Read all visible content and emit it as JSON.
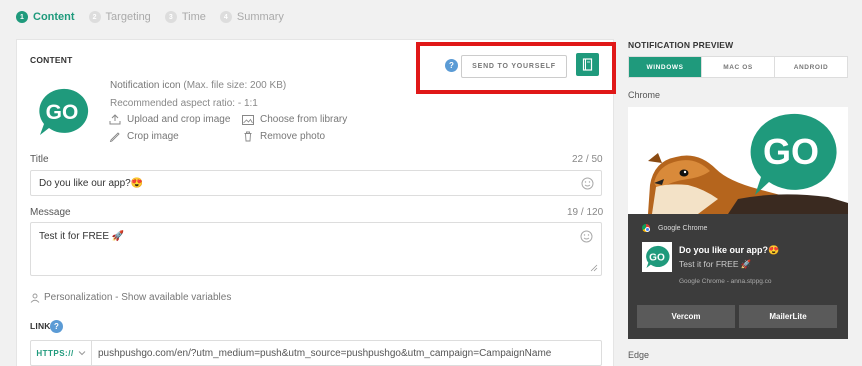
{
  "steps": [
    {
      "num": "1",
      "label": "Content"
    },
    {
      "num": "2",
      "label": "Targeting"
    },
    {
      "num": "3",
      "label": "Time"
    },
    {
      "num": "4",
      "label": "Summary"
    }
  ],
  "content": {
    "title": "CONTENT",
    "help": "?",
    "send_to_yourself": "SEND TO YOURSELF",
    "icon_info": {
      "label": "Notification icon",
      "max_size": "(Max. file size: 200 KB)",
      "aspect": "Recommended aspect ratio: - 1:1"
    },
    "upload_crop": "Upload and crop image",
    "choose_library": "Choose from library",
    "crop_image": "Crop image",
    "remove_photo": "Remove photo",
    "logo_text": "GO",
    "title_field": {
      "label": "Title",
      "counter": "22 / 50",
      "value": "Do you like our app?😍"
    },
    "message_field": {
      "label": "Message",
      "counter": "19 / 120",
      "value": "Test it for FREE 🚀"
    },
    "personalization": "Personalization - Show available variables",
    "link": {
      "label": "LINK",
      "help": "?",
      "scheme": "HTTPS://",
      "url": "pushpushgo.com/en/?utm_medium=push&utm_source=pushpushgo&utm_campaign=CampaignName"
    }
  },
  "preview": {
    "title": "NOTIFICATION PREVIEW",
    "tabs": [
      "WINDOWS",
      "MAC OS",
      "ANDROID"
    ],
    "active_tab": "WINDOWS",
    "browser_chrome": "Chrome",
    "browser_edge": "Edge",
    "notification": {
      "source": "Google Chrome",
      "title": "Do you like our app?😍",
      "message": "Test it for FREE 🚀",
      "meta": "Google Chrome - anna.stppg.co",
      "buttons": [
        "Vercom",
        "MailerLite"
      ]
    }
  },
  "colors": {
    "accent": "#1f9a7c",
    "highlight": "#e01818",
    "help": "#5b9bd5"
  }
}
